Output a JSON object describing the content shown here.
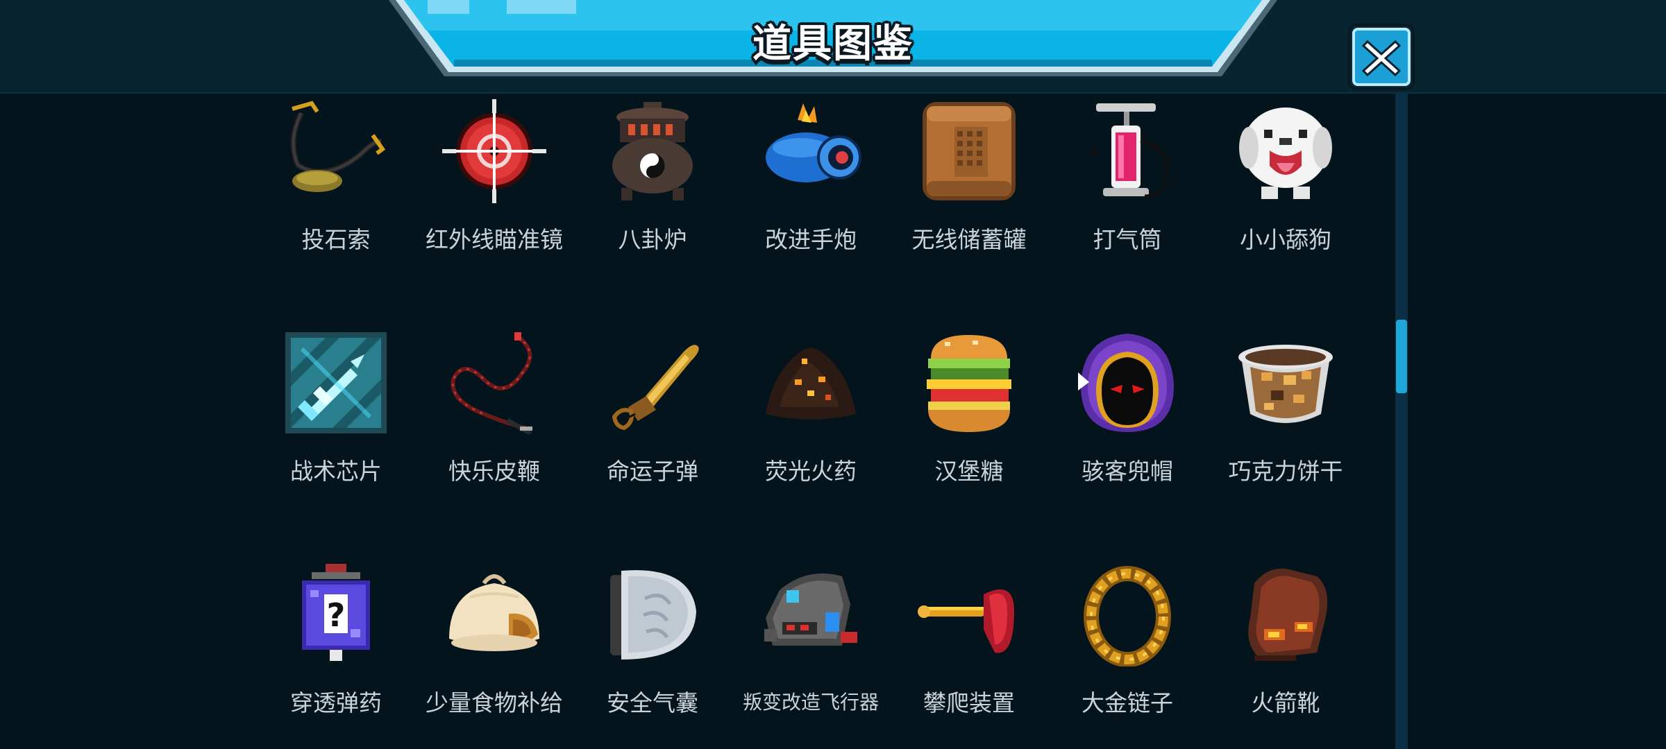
{
  "header": {
    "title": "道具图鉴"
  },
  "colors": {
    "background": "#03141c",
    "banner": "#0bb4e6",
    "scroll_thumb": "#1fa6d8",
    "label": "#c9d3d8"
  },
  "scroll": {
    "position_fraction": 0.39
  },
  "items": [
    {
      "label": "投石索",
      "icon": "sling-icon"
    },
    {
      "label": "红外线瞄准镜",
      "icon": "red-scope-icon"
    },
    {
      "label": "八卦炉",
      "icon": "bagua-furnace-icon"
    },
    {
      "label": "改进手炮",
      "icon": "hand-cannon-icon"
    },
    {
      "label": "无线储蓄罐",
      "icon": "battery-can-icon"
    },
    {
      "label": "打气筒",
      "icon": "air-pump-icon"
    },
    {
      "label": "小小舔狗",
      "icon": "puppy-icon"
    },
    {
      "label": "战术芯片",
      "icon": "tactical-chip-icon"
    },
    {
      "label": "快乐皮鞭",
      "icon": "whip-icon"
    },
    {
      "label": "命运子弹",
      "icon": "bullet-icon"
    },
    {
      "label": "荧光火药",
      "icon": "gunpowder-icon"
    },
    {
      "label": "汉堡糖",
      "icon": "burger-icon"
    },
    {
      "label": "骇客兜帽",
      "icon": "hacker-hood-icon"
    },
    {
      "label": "巧克力饼干",
      "icon": "choco-cookie-icon"
    },
    {
      "label": "穿透弹药",
      "icon": "ammo-box-icon"
    },
    {
      "label": "少量食物补给",
      "icon": "bun-icon"
    },
    {
      "label": "安全气囊",
      "icon": "airbag-icon"
    },
    {
      "label": "叛变改造飞行器",
      "icon": "drone-icon"
    },
    {
      "label": "攀爬装置",
      "icon": "plunger-icon"
    },
    {
      "label": "大金链子",
      "icon": "gold-chain-icon"
    },
    {
      "label": "火箭靴",
      "icon": "rocket-boots-icon"
    }
  ]
}
